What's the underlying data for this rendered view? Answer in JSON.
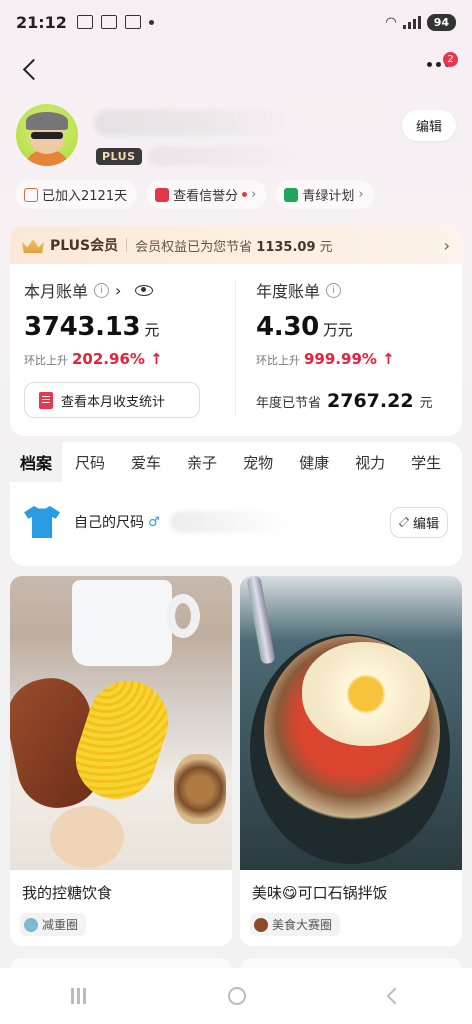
{
  "status_bar": {
    "time": "21:12",
    "battery": "94"
  },
  "nav": {
    "notification_count": "2"
  },
  "profile": {
    "plus_tag": "PLUS",
    "edit_label": "编辑"
  },
  "chips": [
    {
      "label": "已加入2121天"
    },
    {
      "label": "查看信誉分"
    },
    {
      "label": "青绿计划"
    }
  ],
  "plus_card": {
    "title": "PLUS会员",
    "saving_text": "会员权益已为您节省",
    "saving_amount": "1135.09",
    "saving_unit": "元"
  },
  "monthly_bill": {
    "label": "本月账单",
    "amount": "3743.13",
    "unit": "元",
    "mom_label": "环比上升",
    "mom_value": "202.96% ↑",
    "button_label": "查看本月收支统计"
  },
  "yearly_bill": {
    "label": "年度账单",
    "amount": "4.30",
    "unit": "万元",
    "mom_label": "环比上升",
    "mom_value": "999.99% ↑",
    "saved_label": "年度已节省",
    "saved_amount": "2767.22",
    "saved_unit": "元"
  },
  "tabs": [
    "档案",
    "尺码",
    "爱车",
    "亲子",
    "宠物",
    "健康",
    "视力",
    "学生"
  ],
  "size_row": {
    "label": "自己的尺码",
    "gender_icon": "♂",
    "edit_label": "编辑"
  },
  "feed": [
    {
      "title": "我的控糖饮食",
      "tag": "减重圈"
    },
    {
      "title": "美味😋可口石锅拌饭",
      "tag": "美食大赛圈"
    }
  ],
  "colors": {
    "accent_red": "#e8203a",
    "plus_gold": "#f2d9b0",
    "brand_blue": "#2a9be0"
  }
}
